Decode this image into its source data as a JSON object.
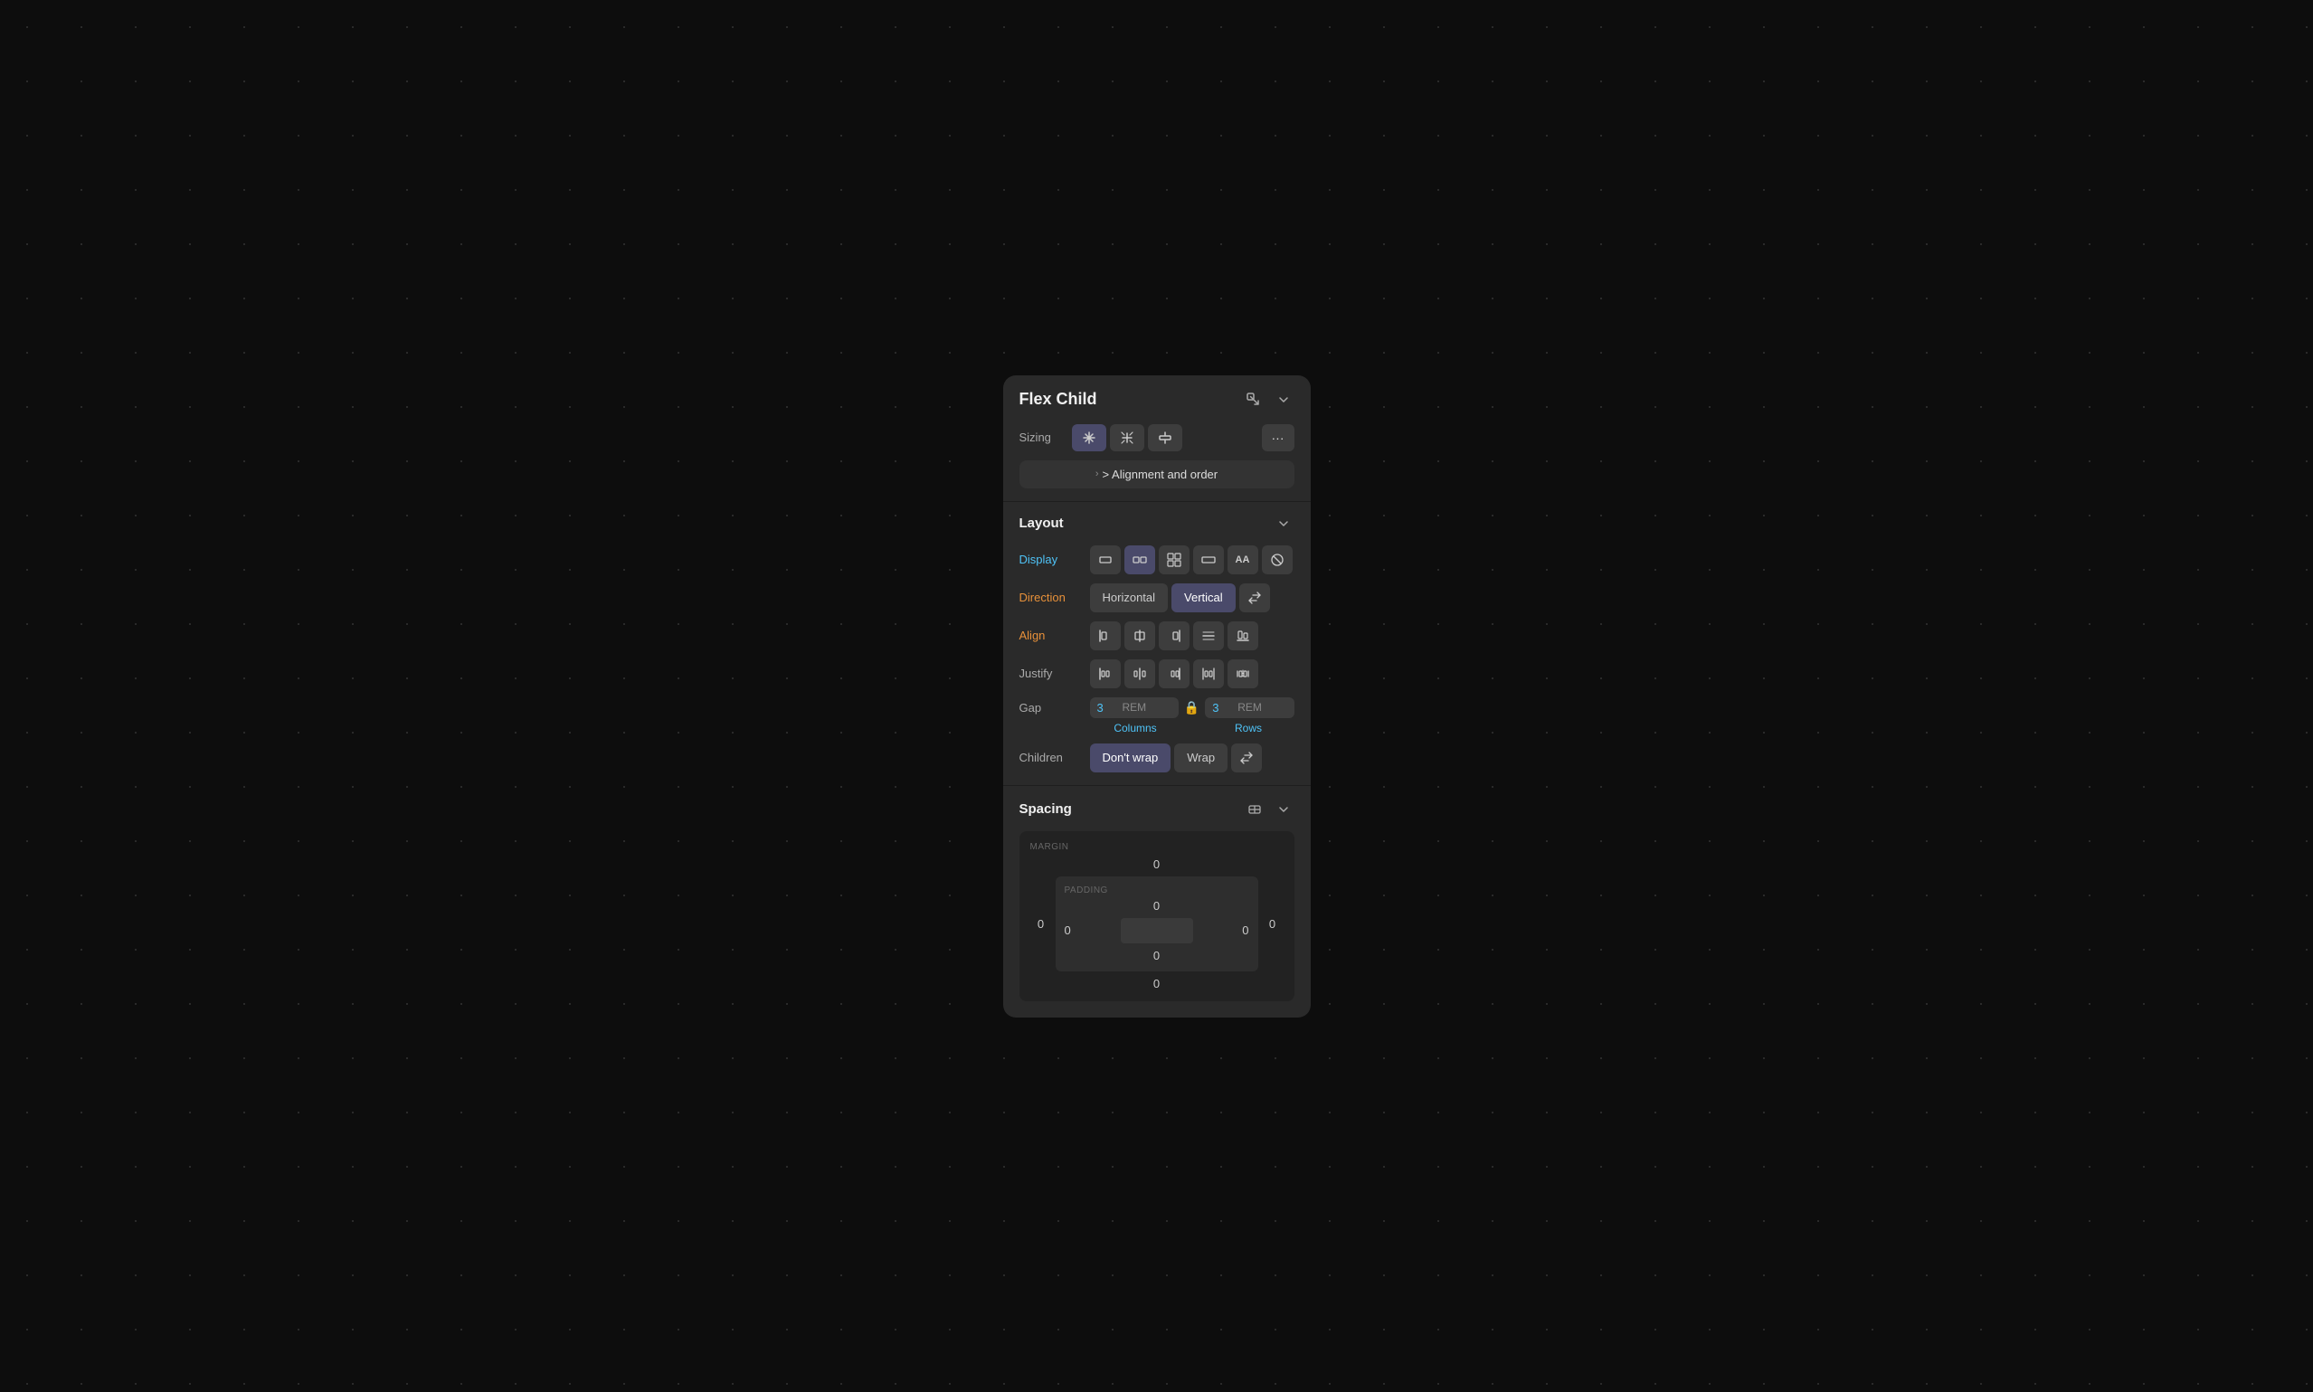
{
  "header": {
    "title": "Flex Child",
    "icon_topleft": "↖",
    "chevron": "▾"
  },
  "sizing": {
    "label": "Sizing",
    "buttons": [
      {
        "id": "expand",
        "symbol": "⊹",
        "active": true
      },
      {
        "id": "fit",
        "symbol": "↕"
      },
      {
        "id": "fixed",
        "symbol": "⊠"
      },
      {
        "id": "more",
        "symbol": "···"
      }
    ]
  },
  "alignment_order": {
    "label": "> Alignment and order"
  },
  "layout": {
    "section_title": "Layout",
    "display": {
      "label": "Display",
      "options": [
        {
          "id": "block",
          "symbol": "▬"
        },
        {
          "id": "flex",
          "symbol": "⊟⊟",
          "active": true
        },
        {
          "id": "grid",
          "symbol": "⊞"
        },
        {
          "id": "inline",
          "symbol": "▭"
        },
        {
          "id": "text",
          "symbol": "AA"
        },
        {
          "id": "none",
          "symbol": "⊘"
        }
      ]
    },
    "direction": {
      "label": "Direction",
      "options": [
        {
          "id": "horizontal",
          "label": "Horizontal"
        },
        {
          "id": "vertical",
          "label": "Vertical",
          "active": true
        }
      ],
      "icon": "←→"
    },
    "align": {
      "label": "Align",
      "options": [
        {
          "id": "start",
          "symbol": "⊢"
        },
        {
          "id": "center",
          "symbol": "⊣⊢"
        },
        {
          "id": "end",
          "symbol": "⊣"
        },
        {
          "id": "stretch",
          "symbol": "↔"
        },
        {
          "id": "baseline",
          "symbol": "⊥"
        }
      ]
    },
    "justify": {
      "label": "Justify",
      "options": [
        {
          "id": "start",
          "symbol": "⊩"
        },
        {
          "id": "center",
          "symbol": "≡"
        },
        {
          "id": "end",
          "symbol": "⊪"
        },
        {
          "id": "space-between",
          "symbol": "⊫"
        },
        {
          "id": "space-around",
          "symbol": "⊬"
        }
      ]
    },
    "gap": {
      "label": "Gap",
      "columns_value": "3",
      "columns_unit": "REM",
      "rows_value": "3",
      "rows_unit": "REM",
      "columns_label": "Columns",
      "rows_label": "Rows"
    },
    "children": {
      "label": "Children",
      "options": [
        {
          "id": "nowrap",
          "label": "Don't wrap",
          "active": true
        },
        {
          "id": "wrap",
          "label": "Wrap"
        }
      ]
    }
  },
  "spacing": {
    "section_title": "Spacing",
    "margin_label": "MARGIN",
    "padding_label": "PADDING",
    "margin_top": "0",
    "margin_right": "0",
    "margin_bottom": "0",
    "margin_left": "0",
    "padding_top": "0",
    "padding_right": "0",
    "padding_bottom": "0",
    "padding_left": "0"
  }
}
